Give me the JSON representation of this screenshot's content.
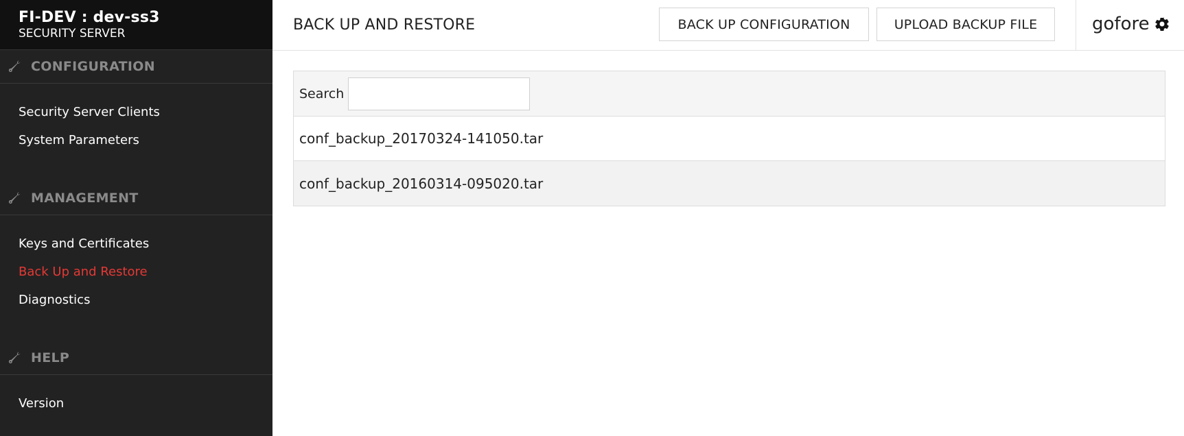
{
  "brand": {
    "title": "FI-DEV : dev-ss3",
    "subtitle": "SECURITY SERVER"
  },
  "sidebar": {
    "sections": [
      {
        "title": "CONFIGURATION",
        "icon": "wrench-icon",
        "items": [
          {
            "label": "Security Server Clients"
          },
          {
            "label": "System Parameters"
          }
        ]
      },
      {
        "title": "MANAGEMENT",
        "icon": "wrench-icon",
        "items": [
          {
            "label": "Keys and Certificates"
          },
          {
            "label": "Back Up and Restore"
          },
          {
            "label": "Diagnostics"
          }
        ]
      },
      {
        "title": "HELP",
        "icon": "wrench-icon",
        "items": [
          {
            "label": "Version"
          }
        ]
      }
    ]
  },
  "header": {
    "title": "BACK UP AND RESTORE",
    "backup_button": "BACK UP CONFIGURATION",
    "upload_button": "UPLOAD BACKUP FILE",
    "username": "gofore",
    "user_icon": "gear-icon"
  },
  "backups": {
    "search_label": "Search",
    "search_value": "",
    "files": [
      {
        "name": "conf_backup_20170324-141050.tar"
      },
      {
        "name": "conf_backup_20160314-095020.tar"
      }
    ]
  },
  "colors": {
    "sidebar_bg": "#222222",
    "brand_bg": "#111111",
    "active_item": "#e53935",
    "section_header": "#8a8a8a"
  }
}
